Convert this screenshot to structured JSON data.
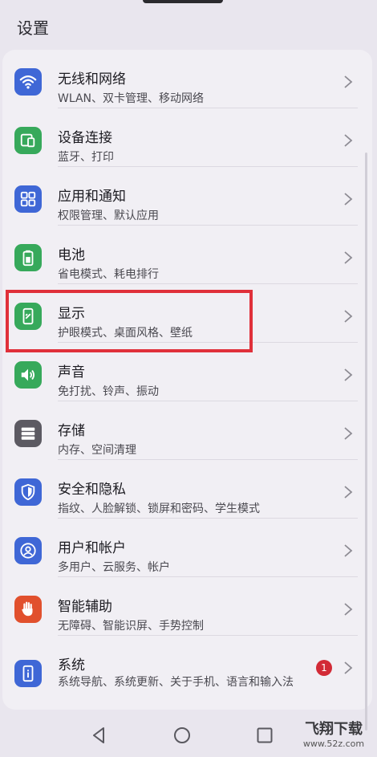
{
  "header": {
    "title": "设置"
  },
  "items": [
    {
      "icon": "wifi-icon",
      "color": "#3f67d6",
      "title": "无线和网络",
      "sub": "WLAN、双卡管理、移动网络"
    },
    {
      "icon": "device-connect-icon",
      "color": "#37a95b",
      "title": "设备连接",
      "sub": "蓝牙、打印"
    },
    {
      "icon": "apps-grid-icon",
      "color": "#3f67d6",
      "title": "应用和通知",
      "sub": "权限管理、默认应用"
    },
    {
      "icon": "battery-icon",
      "color": "#37a95b",
      "title": "电池",
      "sub": "省电模式、耗电排行"
    },
    {
      "icon": "display-icon",
      "color": "#37a95b",
      "title": "显示",
      "sub": "护眼模式、桌面风格、壁纸"
    },
    {
      "icon": "speaker-icon",
      "color": "#37a95b",
      "title": "声音",
      "sub": "免打扰、铃声、振动"
    },
    {
      "icon": "storage-icon",
      "color": "#5c5a62",
      "title": "存储",
      "sub": "内存、空间清理"
    },
    {
      "icon": "shield-icon",
      "color": "#3f67d6",
      "title": "安全和隐私",
      "sub": "指纹、人脸解锁、锁屏和密码、学生模式"
    },
    {
      "icon": "user-icon",
      "color": "#3f67d6",
      "title": "用户和帐户",
      "sub": "多用户、云服务、帐户"
    },
    {
      "icon": "hand-icon",
      "color": "#e1502d",
      "title": "智能辅助",
      "sub": "无障碍、智能识屏、手势控制"
    },
    {
      "icon": "system-phone-icon",
      "color": "#3f67d6",
      "title": "系统",
      "sub": "系统导航、系统更新、关于手机、语言和输入法",
      "badge": "1"
    }
  ],
  "watermark": {
    "text": "飞翔下载",
    "sub": "www.52z.com"
  }
}
